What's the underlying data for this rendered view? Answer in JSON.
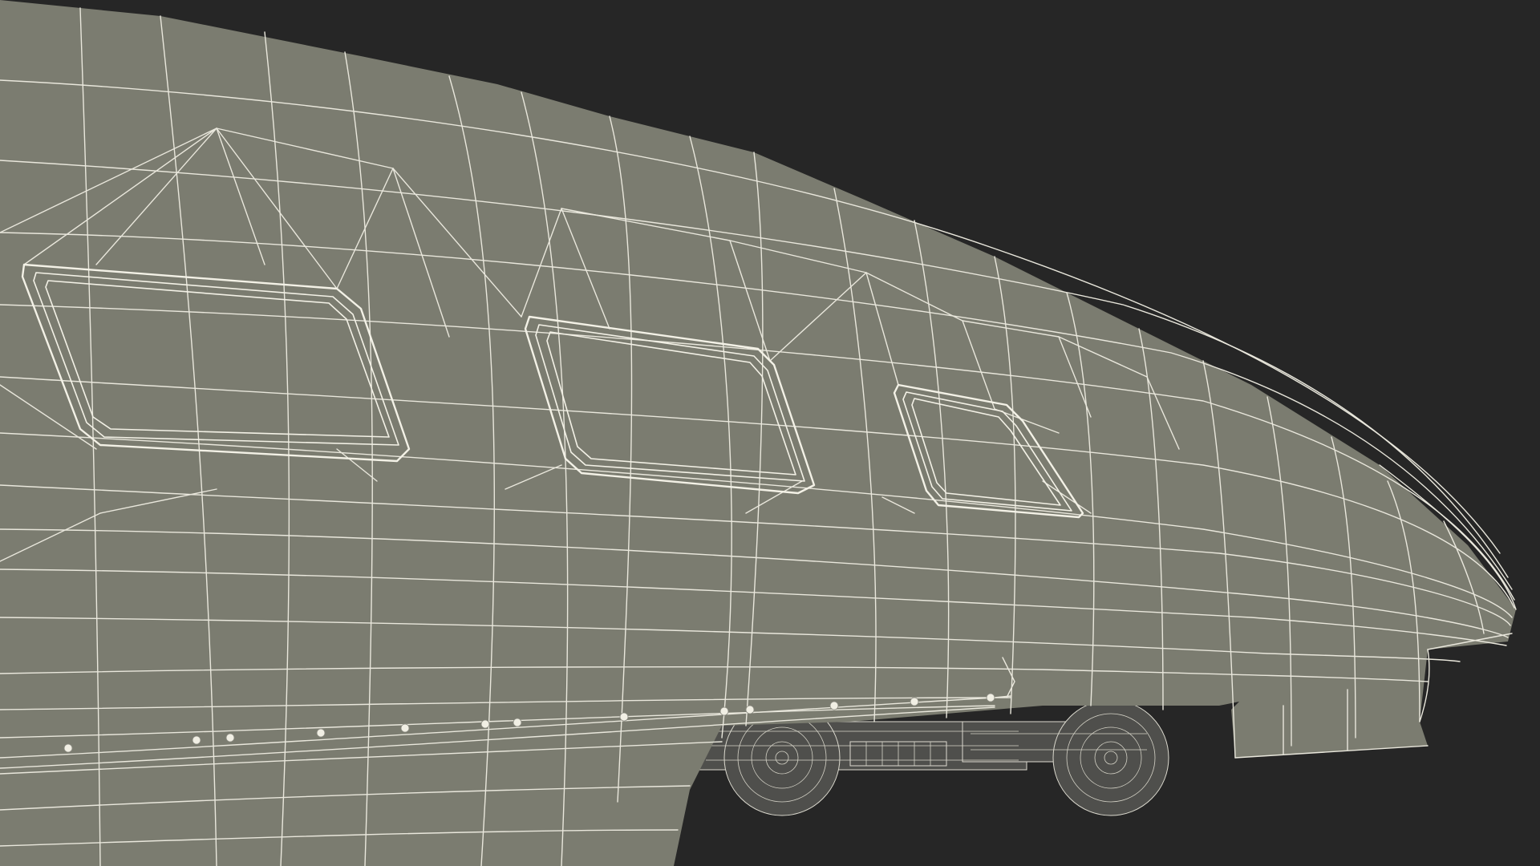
{
  "scene": {
    "subject": "wireframe-train-nose",
    "colors": {
      "background": "#262626",
      "body_fill": "#7b7c70",
      "wire": "#e9e7dc",
      "undercarriage": "#4f4f4c"
    },
    "windows": 3,
    "bogies": 2
  }
}
